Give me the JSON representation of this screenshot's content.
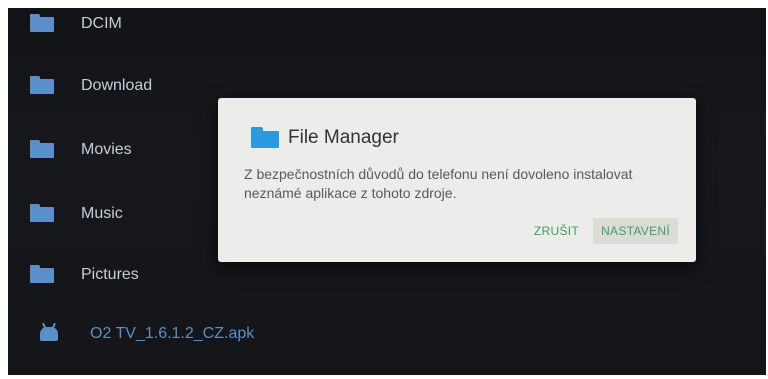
{
  "files": [
    {
      "name": "DCIM",
      "icon": "folder-icon"
    },
    {
      "name": "Download",
      "icon": "folder-icon"
    },
    {
      "name": "Movies",
      "icon": "folder-icon"
    },
    {
      "name": "Music",
      "icon": "folder-icon"
    },
    {
      "name": "Pictures",
      "icon": "folder-icon"
    },
    {
      "name": "O2 TV_1.6.1.2_CZ.apk",
      "icon": "android-icon"
    }
  ],
  "dialog": {
    "title": "File Manager",
    "message": "Z bezpečnostních důvodů do telefonu není dovoleno instalovat neznámé aplikace z tohoto zdroje.",
    "cancel_label": "ZRUŠIT",
    "settings_label": "NASTAVENÍ"
  },
  "colors": {
    "accent_green": "#3d9e5b",
    "folder_blue": "#5a8fc9",
    "dialog_folder_blue": "#2a9be3"
  }
}
